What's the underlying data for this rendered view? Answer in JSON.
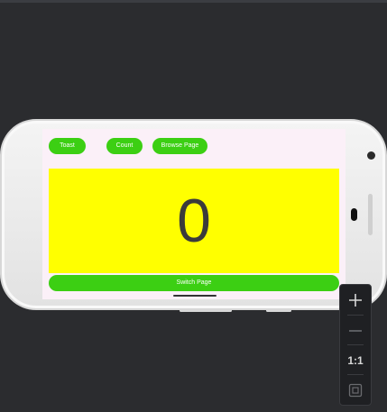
{
  "app": {
    "buttons": {
      "toast_label": "Toast",
      "count_label": "Count",
      "browse_label": "Browse Page"
    },
    "counter": {
      "value": "0"
    },
    "switch_label": "Switch Page"
  },
  "zoom_controls": {
    "zoom_in_icon": "plus-icon",
    "zoom_out_icon": "minus-icon",
    "actual_size_label": "1:1",
    "fit_icon": "fit-screen-icon"
  },
  "colors": {
    "button_green": "#3ccf13",
    "counter_background": "#ffff00",
    "screen_background": "#fbf0f8"
  }
}
